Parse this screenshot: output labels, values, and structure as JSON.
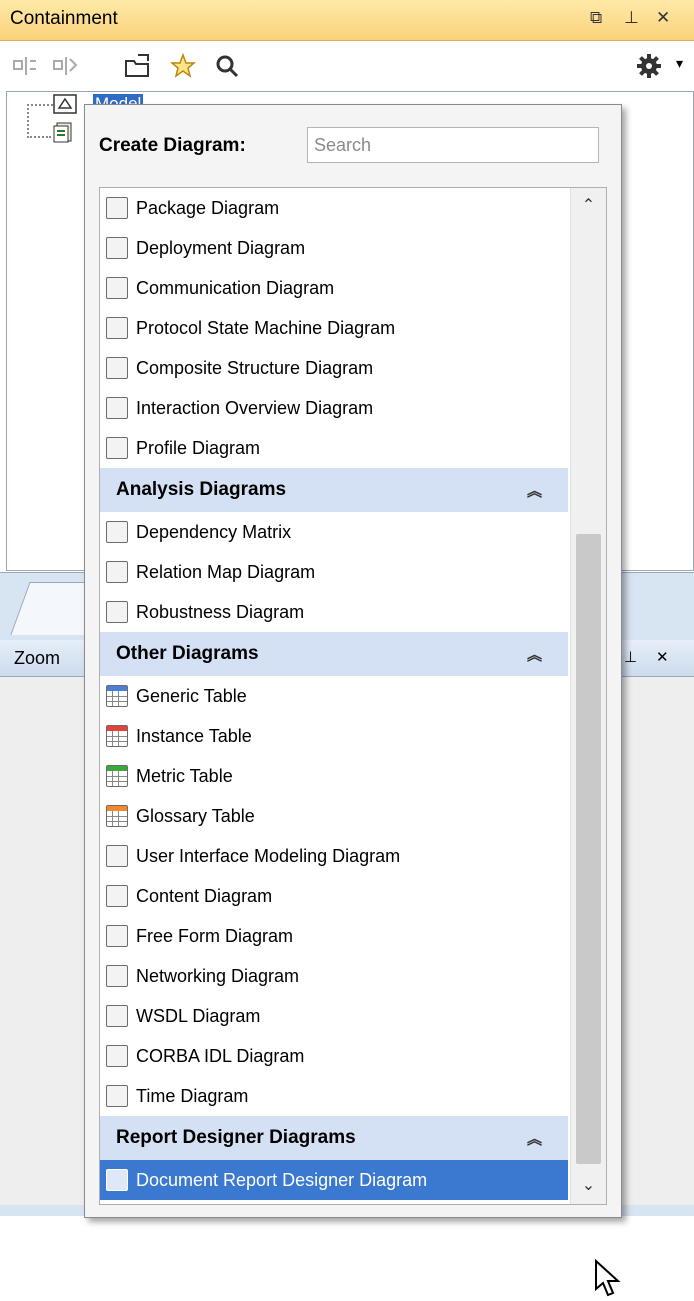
{
  "containment": {
    "title": "Containment",
    "tree_root_label": "Model"
  },
  "zoom": {
    "title": "Zoom"
  },
  "popup": {
    "create_label": "Create Diagram:",
    "search_placeholder": "Search",
    "rows": [
      {
        "kind": "item",
        "label": "Package Diagram",
        "icon": "package-diagram-icon"
      },
      {
        "kind": "item",
        "label": "Deployment Diagram",
        "icon": "deployment-diagram-icon"
      },
      {
        "kind": "item",
        "label": "Communication Diagram",
        "icon": "communication-diagram-icon"
      },
      {
        "kind": "item",
        "label": "Protocol State Machine Diagram",
        "icon": "protocol-state-machine-icon"
      },
      {
        "kind": "item",
        "label": "Composite Structure Diagram",
        "icon": "composite-structure-icon"
      },
      {
        "kind": "item",
        "label": "Interaction Overview Diagram",
        "icon": "interaction-overview-icon"
      },
      {
        "kind": "item",
        "label": "Profile Diagram",
        "icon": "profile-diagram-icon"
      },
      {
        "kind": "category",
        "label": "Analysis Diagrams"
      },
      {
        "kind": "item",
        "label": "Dependency Matrix",
        "icon": "dependency-matrix-icon"
      },
      {
        "kind": "item",
        "label": "Relation Map Diagram",
        "icon": "relation-map-icon"
      },
      {
        "kind": "item",
        "label": "Robustness Diagram",
        "icon": "robustness-diagram-icon"
      },
      {
        "kind": "category",
        "label": "Other Diagrams"
      },
      {
        "kind": "item",
        "label": "Generic Table",
        "icon": "generic-table-icon",
        "table_color": "#4a7fd6"
      },
      {
        "kind": "item",
        "label": "Instance Table",
        "icon": "instance-table-icon",
        "table_color": "#e0443b"
      },
      {
        "kind": "item",
        "label": "Metric Table",
        "icon": "metric-table-icon",
        "table_color": "#3aa83a"
      },
      {
        "kind": "item",
        "label": "Glossary Table",
        "icon": "glossary-table-icon",
        "table_color": "#f08a2a"
      },
      {
        "kind": "item",
        "label": "User Interface Modeling Diagram",
        "icon": "user-interface-modeling-icon"
      },
      {
        "kind": "item",
        "label": "Content Diagram",
        "icon": "content-diagram-icon"
      },
      {
        "kind": "item",
        "label": "Free Form Diagram",
        "icon": "free-form-diagram-icon"
      },
      {
        "kind": "item",
        "label": "Networking Diagram",
        "icon": "networking-diagram-icon"
      },
      {
        "kind": "item",
        "label": "WSDL Diagram",
        "icon": "wsdl-diagram-icon"
      },
      {
        "kind": "item",
        "label": "CORBA IDL Diagram",
        "icon": "corba-idl-diagram-icon"
      },
      {
        "kind": "item",
        "label": "Time Diagram",
        "icon": "time-diagram-icon"
      },
      {
        "kind": "category",
        "label": "Report Designer Diagrams"
      },
      {
        "kind": "item",
        "label": "Document Report Designer Diagram",
        "icon": "document-report-designer-icon",
        "selected": true
      }
    ]
  },
  "colors": {
    "header_bg": "#f9d37a",
    "category_bg": "#d4e1f4",
    "selection_bg": "#3b78d0"
  }
}
